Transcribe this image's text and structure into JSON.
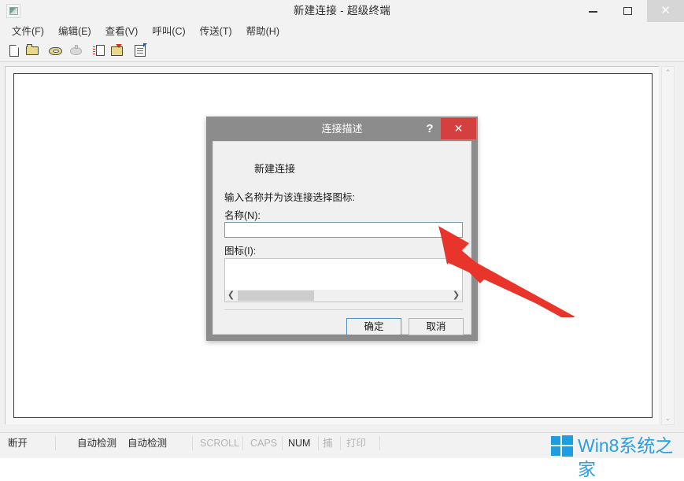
{
  "window": {
    "title": "新建连接 - 超级终端",
    "app_icon": "hyperterminal-icon",
    "minimize_label": "",
    "maximize_label": "",
    "close_label": "✕"
  },
  "menu": {
    "items": [
      {
        "label": "文件(F)"
      },
      {
        "label": "编辑(E)"
      },
      {
        "label": "查看(V)"
      },
      {
        "label": "呼叫(C)"
      },
      {
        "label": "传送(T)"
      },
      {
        "label": "帮助(H)"
      }
    ]
  },
  "toolbar": {
    "buttons": [
      {
        "name": "new-connection-icon",
        "tooltip": "新建连接"
      },
      {
        "name": "open-folder-icon",
        "tooltip": "打开"
      },
      {
        "name": "dial-phone-icon",
        "tooltip": "呼叫"
      },
      {
        "name": "hangup-icon",
        "tooltip": "挂断",
        "disabled": true
      },
      {
        "name": "send-file-icon",
        "tooltip": "发送文件"
      },
      {
        "name": "receive-file-icon",
        "tooltip": "接收文件"
      },
      {
        "name": "properties-icon",
        "tooltip": "属性"
      }
    ]
  },
  "terminal": {
    "content": "",
    "scrollbar_up": "⌃",
    "scrollbar_down": "⌄"
  },
  "dialog": {
    "title": "连接描述",
    "help_label": "?",
    "close_label": "✕",
    "heading": "新建连接",
    "description": "输入名称并为该连接选择图标:",
    "name_label": "名称(N):",
    "name_value": "",
    "name_placeholder": "",
    "icon_label": "图标(I):",
    "scroll_left": "❮",
    "scroll_right": "❯",
    "ok_label": "确定",
    "cancel_label": "取消"
  },
  "annotation": {
    "arrow_color": "#e8342a",
    "arrow_points_to": "name-input-field"
  },
  "statusbar": {
    "connection": "断开",
    "duration": "",
    "detect1": "自动检测",
    "detect2": "自动检测",
    "scroll": "SCROLL",
    "caps": "CAPS",
    "num": "NUM",
    "capture": "捕",
    "print": "打印"
  },
  "watermark": {
    "text": "Win8系统之家",
    "color": "#2b9fe3"
  }
}
